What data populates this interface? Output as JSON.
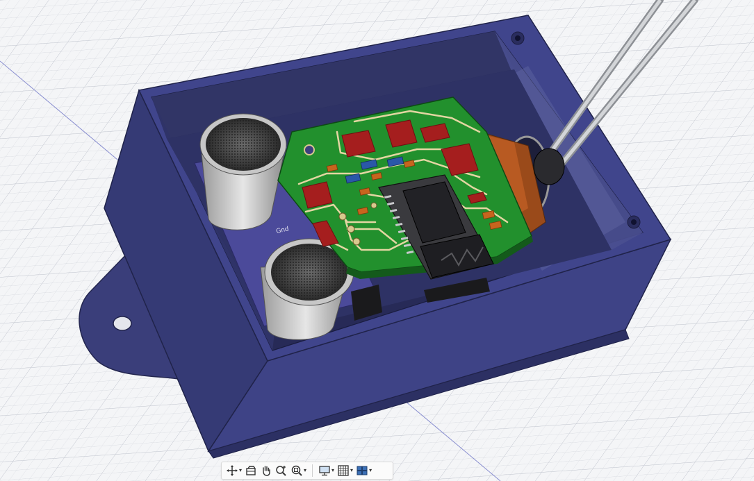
{
  "scene": {
    "background": "#f4f5f7",
    "grid_color": "#c9ccd3",
    "axis_color": "#7c83c9",
    "enclosure_color": "#3d417e",
    "pcb_color": "#1f8a2a",
    "trace_color": "#e6d8a8",
    "smd_red": "#a51e1e",
    "smd_orange": "#c7651e",
    "smd_blue": "#2a58a8",
    "module_color": "#2b2b2e",
    "probe_color": "#b9bcc0"
  },
  "pcb_silkscreen": {
    "gnd_label": "Gnd"
  },
  "nav_toolbar": {
    "items": [
      {
        "icon": "orbit-icon",
        "has_dropdown": true
      },
      {
        "icon": "look-at-icon",
        "has_dropdown": false
      },
      {
        "icon": "pan-hand-icon",
        "has_dropdown": false
      },
      {
        "icon": "zoom-icon",
        "has_dropdown": false
      },
      {
        "icon": "fit-zoom-icon",
        "has_dropdown": true
      },
      {
        "icon": "display-settings-icon",
        "has_dropdown": true
      },
      {
        "icon": "grid-icon",
        "has_dropdown": true
      },
      {
        "icon": "viewports-icon",
        "has_dropdown": true
      }
    ]
  }
}
